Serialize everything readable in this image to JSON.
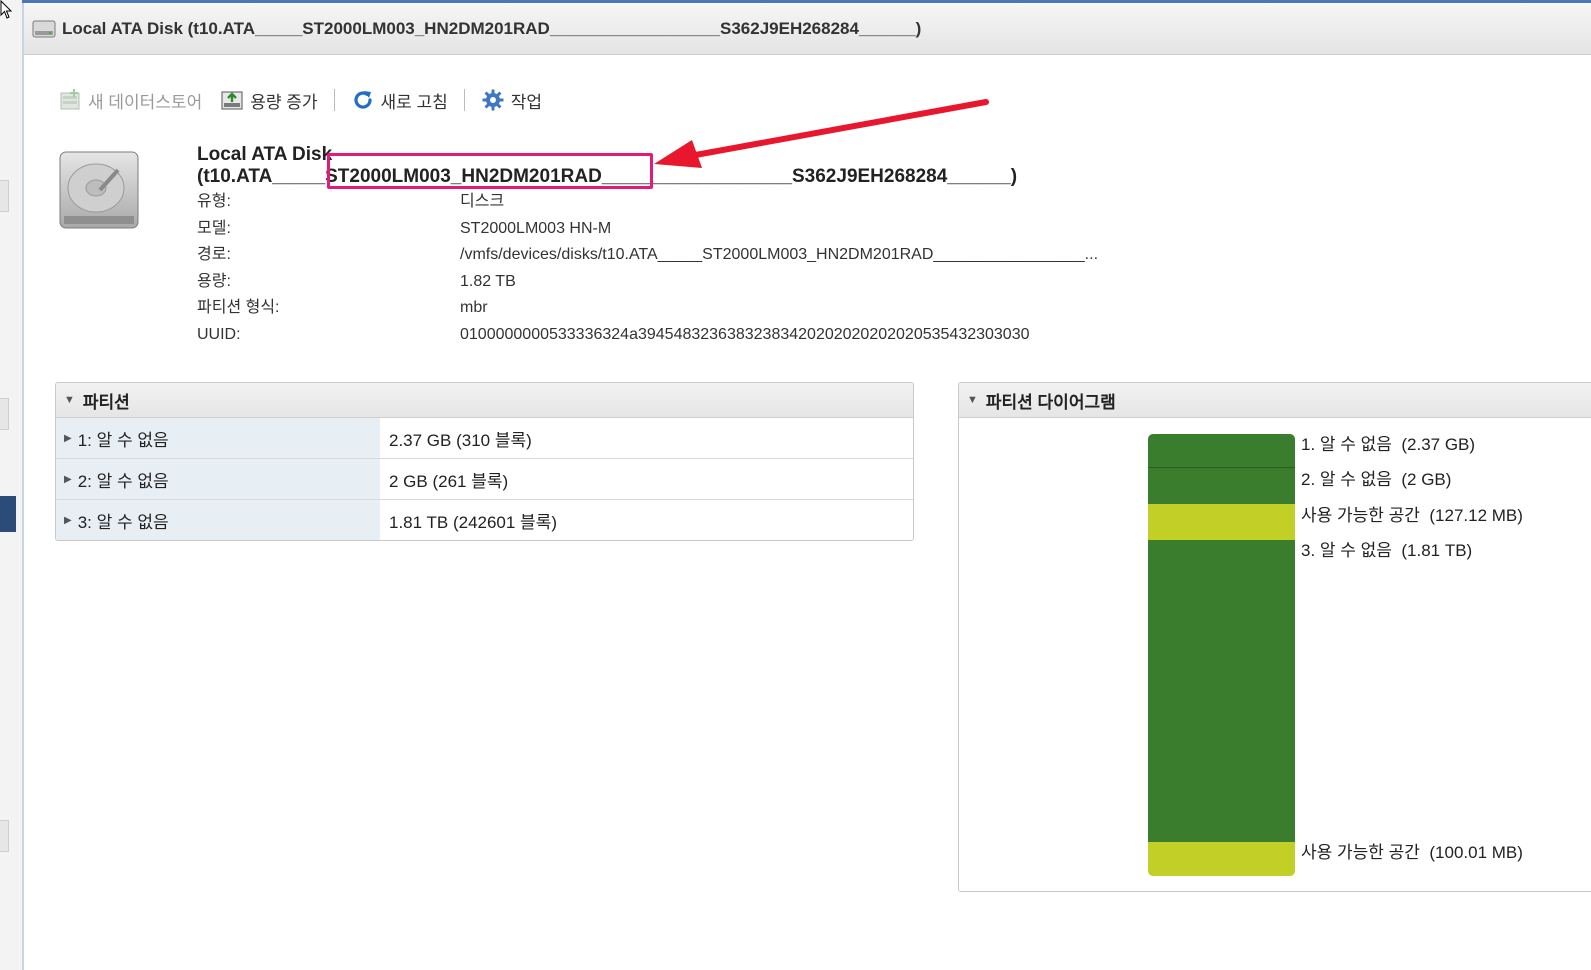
{
  "window": {
    "title": "Local ATA Disk (t10.ATA_____ST2000LM003_HN2DM201RAD__________________S362J9EH268284______)"
  },
  "toolbar": {
    "new_datastore": "새 데이터스토어",
    "increase_capacity": "용량 증가",
    "refresh": "새로 고침",
    "actions": "작업"
  },
  "disk": {
    "name_line1": "Local ATA Disk",
    "name_line2": "(t10.ATA_____ST2000LM003_HN2DM201RAD__________________S362J9EH268284______)",
    "properties": [
      {
        "key": "유형:",
        "value": "디스크"
      },
      {
        "key": "모델:",
        "value": "ST2000LM003 HN-M"
      },
      {
        "key": "경로:",
        "value": "/vmfs/devices/disks/t10.ATA_____ST2000LM003_HN2DM201RAD_________________..."
      },
      {
        "key": "용량:",
        "value": "1.82 TB"
      },
      {
        "key": "파티션 형식:",
        "value": "mbr"
      },
      {
        "key": "UUID:",
        "value": "0100000000533336324a39454832363832383420202020202020535432303030"
      }
    ]
  },
  "partitions": {
    "header": "파티션",
    "rows": [
      {
        "name": "1: 알 수 없음",
        "size": "2.37 GB (310 블록)"
      },
      {
        "name": "2: 알 수 없음",
        "size": "2 GB (261 블록)"
      },
      {
        "name": "3: 알 수 없음",
        "size": "1.81 TB (242601 블록)"
      }
    ]
  },
  "diagram": {
    "header": "파티션 다이어그램",
    "segments": [
      {
        "label": "1. 알 수 없음  (2.37 GB)",
        "kind": "partition"
      },
      {
        "label": "2. 알 수 없음  (2 GB)",
        "kind": "partition"
      },
      {
        "label": "사용 가능한 공간  (127.12 MB)",
        "kind": "free"
      },
      {
        "label": "3. 알 수 없음  (1.81 TB)",
        "kind": "partition"
      },
      {
        "label": "사용 가능한 공간  (100.01 MB)",
        "kind": "free"
      }
    ]
  },
  "colors": {
    "partition": "#3a7d2c",
    "free": "#c2cf27",
    "highlight": "#e6197a",
    "arrow": "#e8172e"
  }
}
